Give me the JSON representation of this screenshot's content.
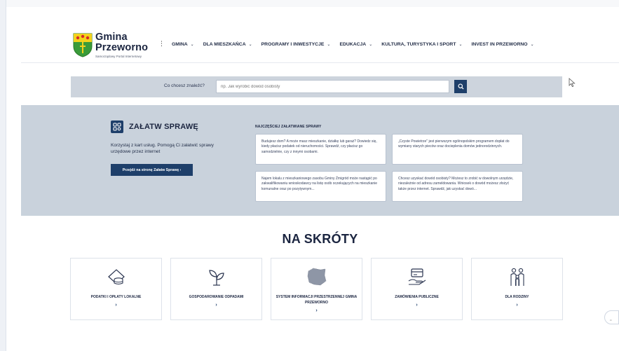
{
  "logo": {
    "name_line1": "Gmina",
    "name_line2": "Przeworno",
    "subtitle": "Samorządowy Portal Internetowy",
    "more": "⋮"
  },
  "nav": [
    {
      "label": "GMINA"
    },
    {
      "label": "DLA MIESZKAŃCA"
    },
    {
      "label": "PROGRAMY I INWESTYCJE"
    },
    {
      "label": "EDUKACJA"
    },
    {
      "label": "KULTURA, TURYSTYKA I SPORT"
    },
    {
      "label": "INVEST IN PRZEWORNO"
    }
  ],
  "search": {
    "label": "Co chcesz znaleźć?",
    "placeholder": "np. Jak wyrobić dowód osobisty",
    "button_icon": "search-icon"
  },
  "zalatw": {
    "title": "ZAŁATW SPRAWĘ",
    "description": "Korzystaj z kart usług. Pomogą Ci załatwić sprawy urzędowe przez internet",
    "button_label": "Przejdź na stronę Załatw Sprawę  ›",
    "most_heading": "NAJCZĘŚCIEJ ZAŁATWIANE SPRAWY",
    "cards": [
      {
        "text": "Budujesz dom? A może masz mieszkanie, działkę lub garaż? Dowiedz się, kiedy płacisz podatek od nieruchomości. Sprawdź, czy płacisz go samodzielnie, czy z innymi osobami."
      },
      {
        "text": "„Czyste Powietrze\" jest pierwszym ogólnopolskim programem dopłat do wymiany starych pieców oraz docieplenia domów jednorodzinnych."
      },
      {
        "text": "Najem lokalu z mieszkaniowego zasobu Gminy Żmigród może nastąpić po zakwalifikowaniu wnioskodawcy na listę osób oczekujących na mieszkanie komunalne oraz po pozytywnym..."
      },
      {
        "text": "Chcesz uzyskać dowód osobisty? Możesz to zrobić w dowolnym urzędzie, niezależnie od adresu zameldowania. Wniosek o dowód możesz złożyć także przez internet. Sprawdź, jak uzyskać dowó..."
      }
    ]
  },
  "skroty": {
    "title": "NA SKRÓTY",
    "chevron": "›",
    "tiles": [
      {
        "label": "PODATKI I OPŁATY LOKALNE",
        "icon": "coins-icon"
      },
      {
        "label": "GOSPODAROWANIE ODPADAMI",
        "icon": "plant-icon"
      },
      {
        "label": "SYSTEM INFORMACJI PRZESTRZENNEJ GMINA PRZEWORNO",
        "icon": "map-icon"
      },
      {
        "label": "ZAMÓWIENIA PUBLICZNE",
        "icon": "payment-card-icon"
      },
      {
        "label": "DLA RODZINY",
        "icon": "family-icon"
      }
    ]
  },
  "colors": {
    "primary": "#1e3f6a",
    "band": "#c9d2dc",
    "search_band": "#cdd4dd",
    "text": "#1b2540"
  }
}
